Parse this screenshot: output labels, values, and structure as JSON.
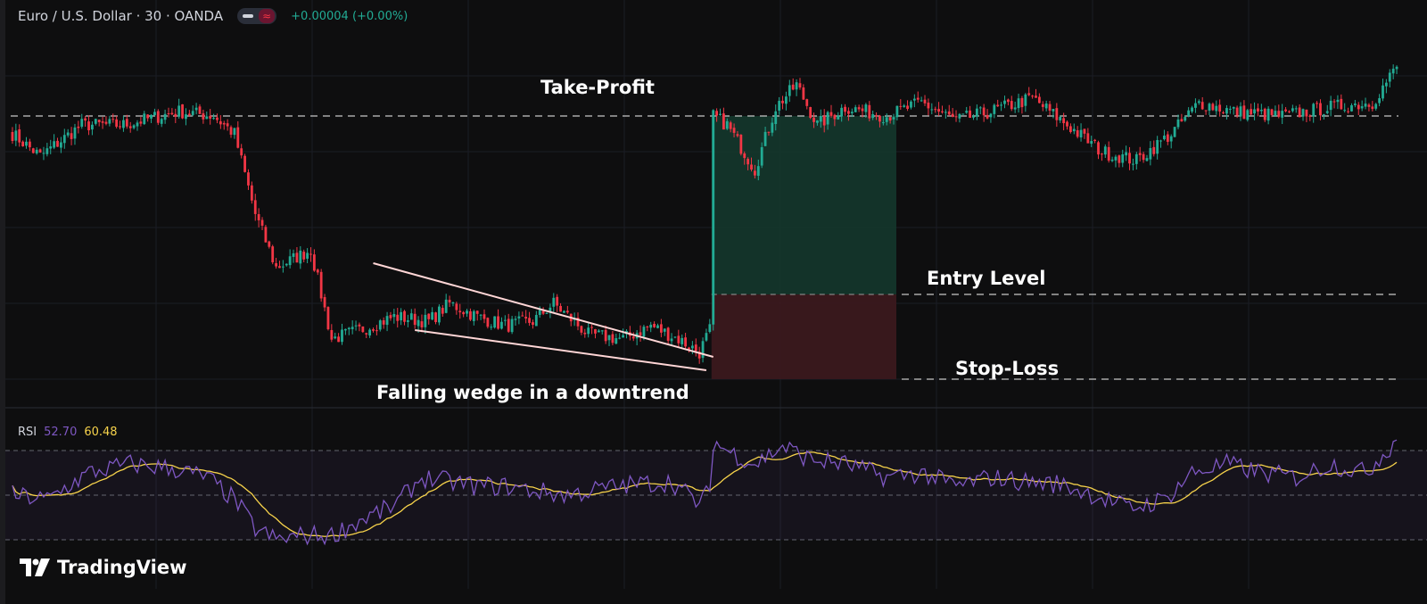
{
  "header": {
    "symbol": "Euro / U.S. Dollar · 30 · OANDA",
    "visibility_icon": "eye-icon",
    "indicator_icon": "wave-icon",
    "wave_glyph": "≈",
    "change": "+0.00004 (+0.00%)"
  },
  "annotations": {
    "take_profit": "Take-Profit",
    "entry_level": "Entry Level",
    "stop_loss": "Stop-Loss",
    "pattern": "Falling wedge in a downtrend"
  },
  "rsi_legend": {
    "name": "RSI",
    "value": "52.70",
    "ma_value": "60.48"
  },
  "brand": {
    "name": "TradingView",
    "icon": "tradingview-logo-icon"
  },
  "colors": {
    "background": "#0e0e0f",
    "up": "#22ab94",
    "down": "#f23645",
    "rsi_line": "#7e57c2",
    "rsi_ma": "#f7d34b",
    "wedge_lines": "#ffd6d6",
    "profit_zone": "#143a2e",
    "loss_zone": "#3d1a1e"
  },
  "chart_data": [
    {
      "type": "candlestick",
      "series": "price",
      "anchors": [
        [
          0,
          1.087
        ],
        [
          8,
          1.0845
        ],
        [
          20,
          1.088
        ],
        [
          32,
          1.088
        ],
        [
          48,
          1.0895
        ],
        [
          58,
          1.089
        ],
        [
          64,
          1.087
        ],
        [
          70,
          1.078
        ],
        [
          76,
          1.072
        ],
        [
          86,
          1.074
        ],
        [
          92,
          1.064
        ],
        [
          100,
          1.065
        ],
        [
          110,
          1.0665
        ],
        [
          120,
          1.066
        ],
        [
          126,
          1.068
        ],
        [
          134,
          1.0665
        ],
        [
          142,
          1.0655
        ],
        [
          150,
          1.066
        ],
        [
          156,
          1.068
        ],
        [
          166,
          1.0645
        ],
        [
          176,
          1.064
        ],
        [
          184,
          1.0655
        ],
        [
          192,
          1.064
        ],
        [
          198,
          1.0625
        ],
        [
          201,
          1.065
        ],
        [
          202,
          1.089
        ],
        [
          206,
          1.088
        ],
        [
          214,
          1.083
        ],
        [
          220,
          1.09
        ],
        [
          226,
          1.0925
        ],
        [
          232,
          1.088
        ],
        [
          240,
          1.09
        ],
        [
          252,
          1.089
        ],
        [
          262,
          1.0905
        ],
        [
          272,
          1.0885
        ],
        [
          282,
          1.0895
        ],
        [
          294,
          1.091
        ],
        [
          304,
          1.088
        ],
        [
          314,
          1.085
        ],
        [
          324,
          1.084
        ],
        [
          334,
          1.087
        ],
        [
          342,
          1.0905
        ],
        [
          352,
          1.0895
        ],
        [
          366,
          1.089
        ],
        [
          380,
          1.09
        ],
        [
          392,
          1.0905
        ],
        [
          399,
          1.0945
        ]
      ],
      "levels": {
        "take_profit": 1.089,
        "entry": 1.069,
        "stop_loss": 1.0595
      },
      "wedge": {
        "upper": [
          [
            104,
            1.0725
          ],
          [
            202,
            1.062
          ]
        ],
        "lower": [
          [
            116,
            1.065
          ],
          [
            200,
            1.0605
          ]
        ]
      },
      "ylim": [
        1.06,
        1.095
      ]
    },
    {
      "type": "line",
      "series": "RSI",
      "anchors": [
        [
          0,
          50
        ],
        [
          10,
          48
        ],
        [
          22,
          60
        ],
        [
          34,
          64
        ],
        [
          46,
          62
        ],
        [
          56,
          58
        ],
        [
          64,
          48
        ],
        [
          70,
          35
        ],
        [
          76,
          30
        ],
        [
          84,
          32
        ],
        [
          92,
          32
        ],
        [
          102,
          40
        ],
        [
          110,
          45
        ],
        [
          118,
          58
        ],
        [
          126,
          56
        ],
        [
          134,
          54
        ],
        [
          142,
          54
        ],
        [
          150,
          52
        ],
        [
          160,
          50
        ],
        [
          170,
          53
        ],
        [
          180,
          55
        ],
        [
          190,
          56
        ],
        [
          198,
          46
        ],
        [
          201,
          52
        ],
        [
          202,
          74
        ],
        [
          206,
          70
        ],
        [
          214,
          64
        ],
        [
          222,
          72
        ],
        [
          230,
          66
        ],
        [
          240,
          64
        ],
        [
          252,
          58
        ],
        [
          262,
          60
        ],
        [
          272,
          54
        ],
        [
          282,
          58
        ],
        [
          292,
          56
        ],
        [
          302,
          55
        ],
        [
          312,
          50
        ],
        [
          322,
          44
        ],
        [
          332,
          48
        ],
        [
          340,
          60
        ],
        [
          350,
          64
        ],
        [
          360,
          60
        ],
        [
          370,
          58
        ],
        [
          380,
          64
        ],
        [
          390,
          60
        ],
        [
          399,
          75
        ]
      ],
      "ylim": [
        20,
        80
      ],
      "bands": [
        30,
        50,
        70
      ]
    }
  ]
}
